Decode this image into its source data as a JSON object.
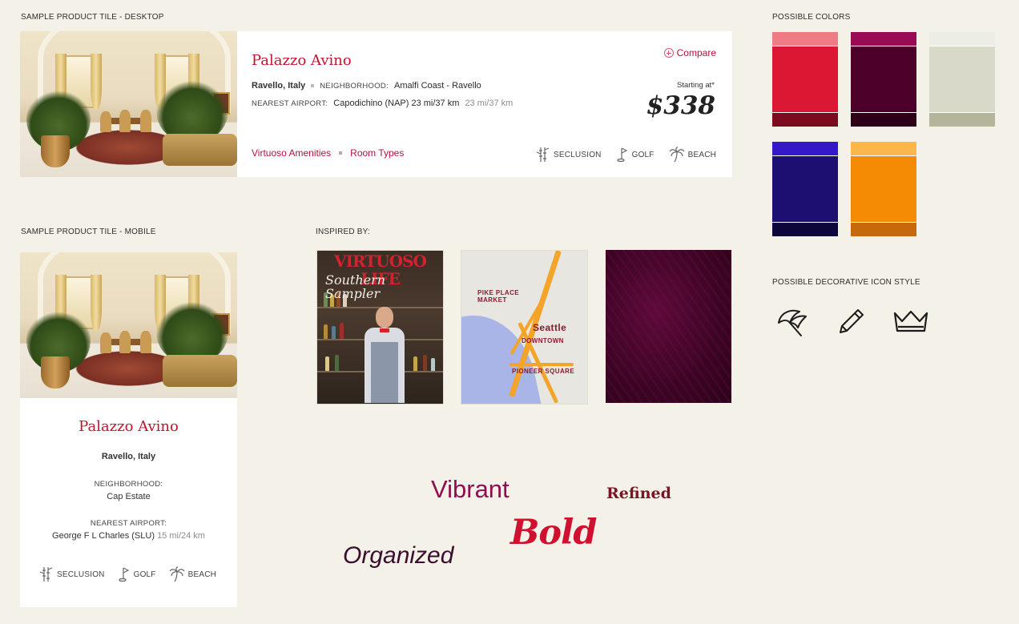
{
  "labels": {
    "desktop": "SAMPLE PRODUCT TILE - DESKTOP",
    "mobile": "SAMPLE PRODUCT TILE - MOBILE",
    "inspired": "INSPIRED BY:",
    "colors": "POSSIBLE COLORS",
    "icons": "POSSIBLE DECORATIVE ICON STYLE"
  },
  "desktop_tile": {
    "title": "Palazzo Avino",
    "compare": "Compare",
    "location": "Ravello, Italy",
    "neighborhood_label": "NEIGHBORHOOD:",
    "neighborhood": "Amalfi Coast - Ravello",
    "airport_label": "NEAREST AIRPORT:",
    "airport": "Capodichino (NAP) 23 mi/37 km",
    "airport_distance": "23 mi/37 km",
    "starting_at": "Starting at*",
    "price": "$338",
    "link_amenities": "Virtuoso Amenities",
    "link_rooms": "Room Types",
    "amenities": [
      "SECLUSION",
      "GOLF",
      "BEACH"
    ]
  },
  "mobile_tile": {
    "title": "Palazzo Avino",
    "location": "Ravello, Italy",
    "neighborhood_label": "NEIGHBORHOOD:",
    "neighborhood": "Cap Estate",
    "airport_label": "NEAREST AIRPORT:",
    "airport": "George F L Charles (SLU)",
    "airport_distance": "15 mi/24 km",
    "amenities": [
      "SECLUSION",
      "GOLF",
      "BEACH"
    ]
  },
  "inspired": {
    "magazine_masthead": "VIRTUOSO LIFE",
    "magazine_headline_1": "Southern",
    "magazine_headline_2": "Sampler",
    "map_labels": [
      "PIKE PLACE MARKET",
      "Seattle",
      "DOWNTOWN",
      "PIONEER SQUARE"
    ]
  },
  "mood_words": {
    "vibrant": "Vibrant",
    "refined": "Refined",
    "bold": "Bold",
    "organized": "Organized"
  },
  "colors": {
    "red": [
      "#ef7c84",
      "#dc1733",
      "#7c0b1f"
    ],
    "magenta": [
      "#9a0b55",
      "#4d0029",
      "#2e0018"
    ],
    "sage": [
      "#ecede5",
      "#d8d9c9",
      "#b4b59a"
    ],
    "indigo": [
      "#3418c9",
      "#1d0f72",
      "#0d063a"
    ],
    "orange": [
      "#fbb74b",
      "#f58b05",
      "#c7680a"
    ],
    "accent_text": "#c8102e",
    "link": "#b5123a"
  },
  "decorative_icons": [
    "umbrella-icon",
    "pencil-icon",
    "crown-icon"
  ]
}
